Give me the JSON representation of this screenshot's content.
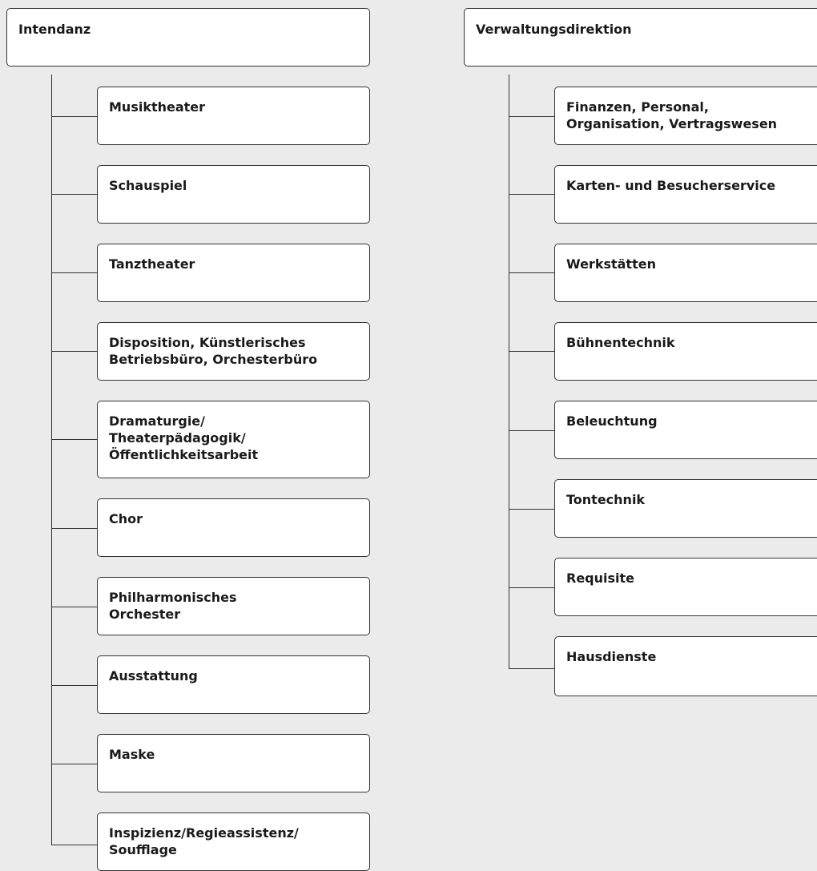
{
  "columns": [
    {
      "root": "Intendanz",
      "children": [
        [
          "Musiktheater"
        ],
        [
          "Schauspiel"
        ],
        [
          "Tanztheater"
        ],
        [
          "Disposition, Künstlerisches",
          "Betriebsbüro, Orchesterbüro"
        ],
        [
          "Dramaturgie/",
          "Theaterpädagogik/",
          "Öffentlichkeitsarbeit"
        ],
        [
          "Chor"
        ],
        [
          "Philharmonisches",
          "Orchester"
        ],
        [
          "Ausstattung"
        ],
        [
          "Maske"
        ],
        [
          "Inspizienz/Regieassistenz/",
          "Soufflage"
        ]
      ]
    },
    {
      "root": "Verwaltungsdirektion",
      "children": [
        [
          "Finanzen, Personal,",
          "Organisation, Vertragswesen"
        ],
        [
          "Karten- und Besucherservice"
        ],
        [
          "Werkstätten"
        ],
        [
          "Bühnentechnik"
        ],
        [
          "Beleuchtung"
        ],
        [
          "Tontechnik"
        ],
        [
          "Requisite"
        ],
        [
          "Hausdienste"
        ]
      ]
    }
  ]
}
